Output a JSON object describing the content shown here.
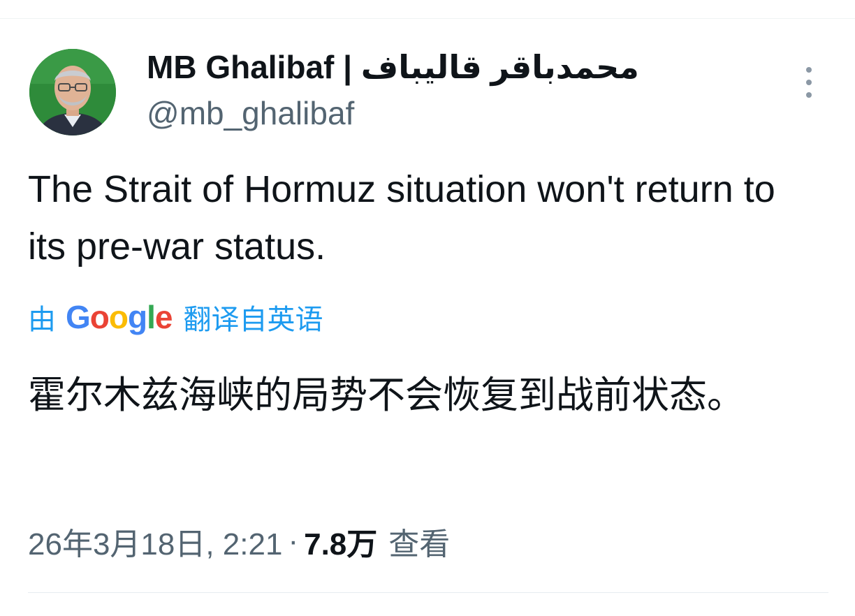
{
  "tweet": {
    "author": {
      "display_name": "MB Ghalibaf | محمدباقر قالیباف",
      "handle": "@mb_ghalibaf",
      "avatar_icon": "profile-photo"
    },
    "more_icon": "more-vertical-icon",
    "text": "The Strait of Hormuz situation won't return to its pre-war status.",
    "translation": {
      "prefix": "由",
      "provider_letters": [
        "G",
        "o",
        "o",
        "g",
        "l",
        "e"
      ],
      "suffix": "翻译自英语",
      "text": "霍尔木兹海峡的局势不会恢复到战前状态。"
    },
    "meta": {
      "timestamp": "26年3月18日, 2:21",
      "separator": "·",
      "views": "7.8万",
      "views_label": "查看"
    }
  },
  "colors": {
    "text_primary": "#0f1419",
    "text_secondary": "#536471",
    "link": "#1d9bf0",
    "google_blue": "#4285f4",
    "google_red": "#ea4335",
    "google_yellow": "#fbbc05",
    "google_green": "#34a853",
    "avatar_background": "#2e8b3a"
  }
}
